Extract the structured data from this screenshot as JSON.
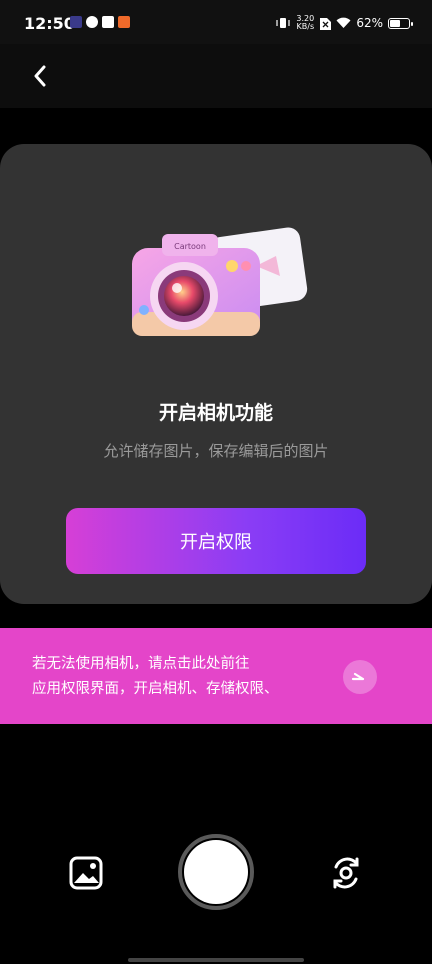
{
  "status_bar": {
    "time": "12:50",
    "net_speed_value": "3.20",
    "net_speed_unit": "KB/s",
    "battery": "62%",
    "battery_level": 0.62
  },
  "header": {
    "back_icon": "chevron-left-icon"
  },
  "card": {
    "title": "开启相机功能",
    "subtitle": "允许储存图片，保存编辑后的图片",
    "button_label": "开启权限",
    "camera_brand": "Cartoon"
  },
  "banner": {
    "line1": "若无法使用相机，请点击此处前往",
    "line2": "应用权限界面，开启相机、存储权限、",
    "arrow_icon": "arrow-right-icon"
  },
  "bottom_bar": {
    "gallery_icon": "image-icon",
    "shutter": "shutter-button",
    "switch_icon": "switch-camera-icon"
  },
  "colors": {
    "banner": "#e445c9",
    "button_start": "#d63fd6",
    "button_end": "#6b2cf7",
    "card": "#333333"
  }
}
